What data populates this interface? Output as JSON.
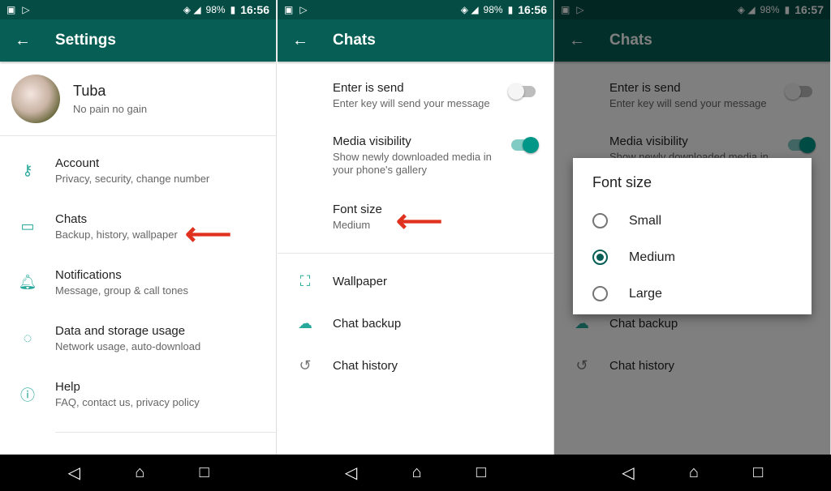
{
  "colors": {
    "header": "#075e54",
    "statusbar": "#054d44",
    "accent": "#26a89a",
    "arrow": "#e0301e"
  },
  "panels": [
    {
      "status": {
        "battery": "98%",
        "time": "16:56"
      },
      "title": "Settings",
      "profile": {
        "name": "Tuba",
        "status": "No pain no gain"
      },
      "items": [
        {
          "icon": "key-icon",
          "label": "Account",
          "sub": "Privacy, security, change number"
        },
        {
          "icon": "chat-icon",
          "label": "Chats",
          "sub": "Backup, history, wallpaper"
        },
        {
          "icon": "bell-icon",
          "label": "Notifications",
          "sub": "Message, group & call tones"
        },
        {
          "icon": "data-usage-icon",
          "label": "Data and storage usage",
          "sub": "Network usage, auto-download"
        },
        {
          "icon": "help-icon",
          "label": "Help",
          "sub": "FAQ, contact us, privacy policy"
        }
      ]
    },
    {
      "status": {
        "battery": "98%",
        "time": "16:56"
      },
      "title": "Chats",
      "settings": [
        {
          "label": "Enter is send",
          "sub": "Enter key will send your message",
          "toggle": false
        },
        {
          "label": "Media visibility",
          "sub": "Show newly downloaded media in your phone's gallery",
          "toggle": true
        },
        {
          "label": "Font size",
          "sub": "Medium"
        }
      ],
      "items": [
        {
          "icon": "wallpaper-icon",
          "label": "Wallpaper"
        },
        {
          "icon": "cloud-backup-icon",
          "label": "Chat backup"
        },
        {
          "icon": "history-icon",
          "label": "Chat history"
        }
      ]
    },
    {
      "status": {
        "battery": "98%",
        "time": "16:57"
      },
      "dialog": {
        "title": "Font size",
        "options": [
          {
            "label": "Small",
            "selected": false
          },
          {
            "label": "Medium",
            "selected": true
          },
          {
            "label": "Large",
            "selected": false
          }
        ]
      }
    }
  ]
}
